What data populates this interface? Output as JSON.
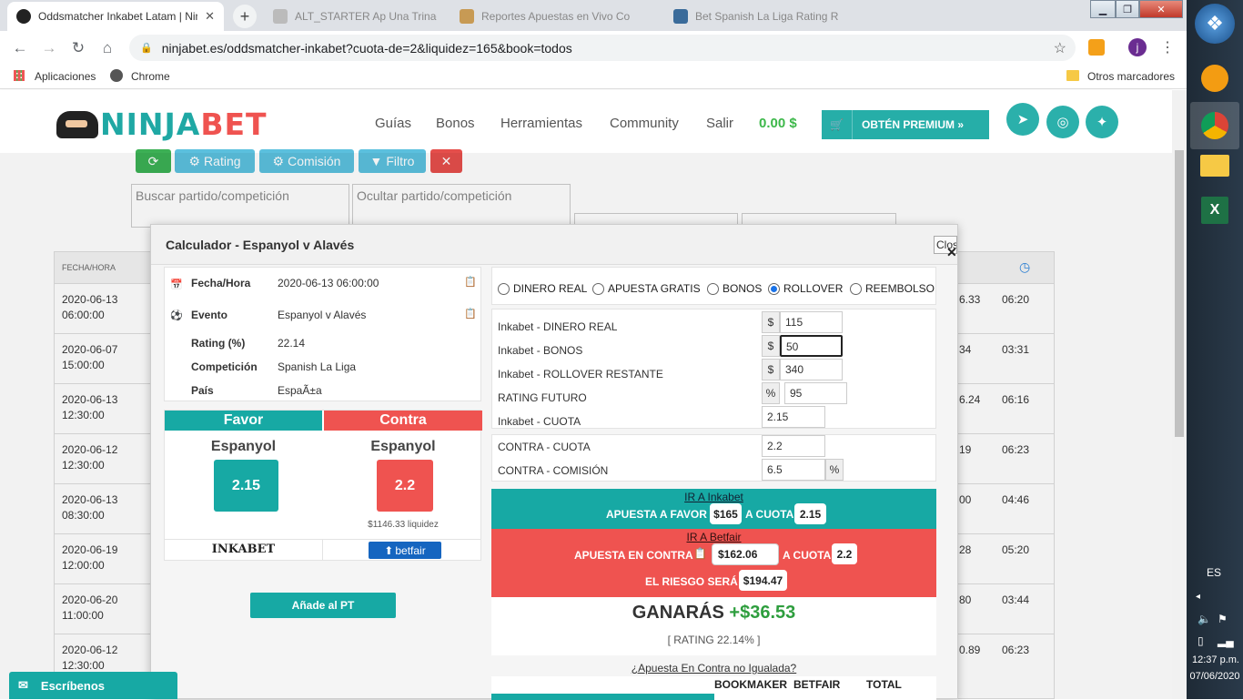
{
  "browser": {
    "tabs": [
      {
        "title": "Oddsmatcher Inkabet Latam | Nin",
        "active": true
      },
      {
        "title": "ALT_STARTER Ap Una Trinado",
        "active": false
      },
      {
        "title": "Reportes Apuestas en Vivo Co",
        "active": false
      },
      {
        "title": "Bet Spanish La Liga Rating R",
        "active": false
      }
    ],
    "url": "ninjabet.es/oddsmatcher-inkabet?cuota-de=2&liquidez=165&book=todos",
    "bookmarks": {
      "apps": "Aplicaciones",
      "chrome": "Chrome",
      "others": "Otros marcadores"
    },
    "profile_initial": "j"
  },
  "site": {
    "logo_a": "NINJA",
    "logo_b": "BET",
    "nav": [
      "Guías",
      "Bonos",
      "Herramientas",
      "Community",
      "Salir"
    ],
    "balance": "0.00 $",
    "premium": "OBTÉN PREMIUM »"
  },
  "toolbar": {
    "rating": "Rating",
    "comision": "Comisión",
    "filtro": "Filtro"
  },
  "search": {
    "buscar": "Buscar partido/competición",
    "ocultar": "Ocultar partido/competición"
  },
  "table": {
    "header": "FECHA/HORA",
    "rows": [
      {
        "date": "2020-06-13",
        "time": "06:00:00",
        "c1": "6.33",
        "c2": "06:20"
      },
      {
        "date": "2020-06-07",
        "time": "15:00:00",
        "c1": "34",
        "c2": "03:31"
      },
      {
        "date": "2020-06-13",
        "time": "12:30:00",
        "c1": "6.24",
        "c2": "06:16"
      },
      {
        "date": "2020-06-12",
        "time": "12:30:00",
        "c1": "19",
        "c2": "06:23"
      },
      {
        "date": "2020-06-13",
        "time": "08:30:00",
        "c1": "00",
        "c2": "04:46"
      },
      {
        "date": "2020-06-19",
        "time": "12:00:00",
        "c1": "28",
        "c2": "05:20"
      },
      {
        "date": "2020-06-20",
        "time": "11:00:00",
        "c1": "80",
        "c2": "03:44"
      },
      {
        "date": "2020-06-12",
        "time": "12:30:00",
        "c1": "0.89",
        "c2": "06:23"
      }
    ]
  },
  "modal": {
    "title": "Calculador - Espanyol v Alavés",
    "close": "Clos",
    "info": [
      {
        "label": "Fecha/Hora",
        "value": "2020-06-13 06:00:00"
      },
      {
        "label": "Evento",
        "value": "Espanyol v Alavés"
      },
      {
        "label": "Rating (%)",
        "value": "22.14"
      },
      {
        "label": "Competición",
        "value": "Spanish La Liga"
      },
      {
        "label": "País",
        "value": "EspaÃ±a"
      }
    ],
    "favor": {
      "header": "Favor",
      "team": "Espanyol",
      "odds": "2.15",
      "book": "INKABET"
    },
    "contra": {
      "header": "Contra",
      "team": "Espanyol",
      "odds": "2.2",
      "liquidity": "$1146.33 liquidez",
      "book": "betfair"
    },
    "add_pt": "Añade al PT",
    "options": [
      "DINERO REAL",
      "APUESTA GRATIS",
      "BONOS",
      "ROLLOVER",
      "REEMBOLSO"
    ],
    "selected_option": "ROLLOVER",
    "fields": [
      {
        "label": "Inkabet - DINERO REAL",
        "addon": "$",
        "value": "115"
      },
      {
        "label": "Inkabet - BONOS",
        "addon": "$",
        "value": "50"
      },
      {
        "label": "Inkabet - ROLLOVER RESTANTE",
        "addon": "$",
        "value": "340"
      },
      {
        "label": "RATING FUTURO",
        "addon": "%",
        "value": "95"
      },
      {
        "label": "Inkabet - CUOTA",
        "addon": "",
        "value": "2.15"
      }
    ],
    "contra_fields": [
      {
        "label": "CONTRA - CUOTA",
        "value": "2.2"
      },
      {
        "label": "CONTRA - COMISIÓN",
        "value": "6.5",
        "addon": "%"
      }
    ],
    "result": {
      "ir_inkabet": "IR A Inkabet",
      "apuesta_favor": "APUESTA A FAVOR",
      "favor_amount": "$165",
      "a_cuota": "A CUOTA",
      "favor_cuota": "2.15",
      "ir_betfair": "IR A Betfair",
      "apuesta_contra": "APUESTA EN CONTRA",
      "contra_amount": "$162.06",
      "contra_cuota": "2.2",
      "riesgo": "EL RIESGO SERÁ",
      "riesgo_amount": "$194.47",
      "ganaras": "GANARÁS",
      "ganaras_amount": "+$36.53",
      "rating": "[ RATING 22.14% ]",
      "no_igualada": "¿Apuesta En Contra no Igualada?",
      "cols": [
        "BOOKMAKER",
        "BETFAIR",
        "TOTAL"
      ]
    }
  },
  "chat": "Escríbenos",
  "taskbar": {
    "lang": "ES",
    "time": "12:37 p.m.",
    "date": "07/06/2020"
  },
  "colors": {
    "teal": "#17a9a4",
    "red": "#ef5350",
    "green": "#2e9e3e"
  }
}
